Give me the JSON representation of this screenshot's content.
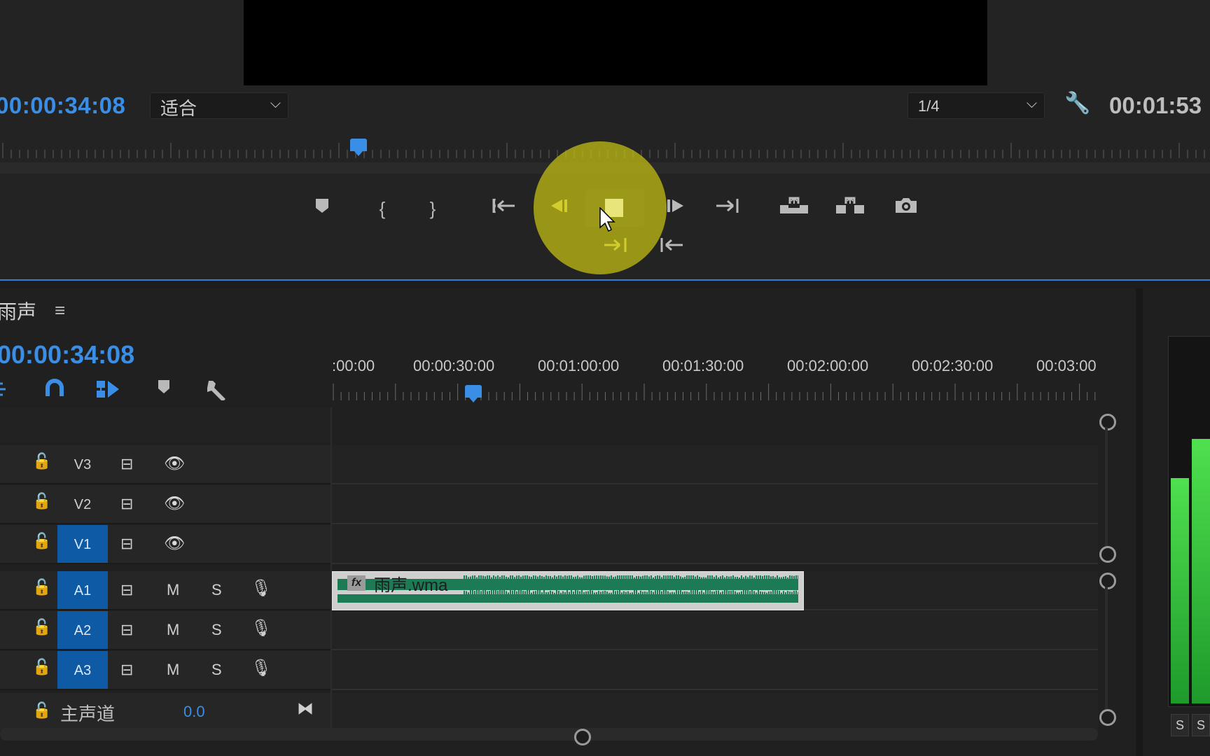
{
  "monitor": {
    "timecode": "00:00:34:08",
    "zoom_fit": "适合",
    "resolution": "1/4",
    "duration": "00:01:53",
    "buttons": [
      "add-marker",
      "mark-in",
      "mark-out",
      "go-to-in",
      "step-back",
      "stop",
      "step-forward",
      "go-to-out",
      "lift",
      "extract",
      "export-frame",
      "insert",
      "overwrite"
    ]
  },
  "timeline": {
    "sequence_name": "雨声",
    "timecode": "00:00:34:08",
    "ruler_labels": [
      ":00:00",
      "00:00:30:00",
      "00:01:00:00",
      "00:01:30:00",
      "00:02:00:00",
      "00:02:30:00",
      "00:03:00"
    ],
    "video_tracks": [
      {
        "name": "V3",
        "targeted": false
      },
      {
        "name": "V2",
        "targeted": false
      },
      {
        "name": "V1",
        "targeted": true
      }
    ],
    "audio_tracks": [
      {
        "name": "A1",
        "mute": "M",
        "solo": "S"
      },
      {
        "name": "A2",
        "mute": "M",
        "solo": "S"
      },
      {
        "name": "A3",
        "mute": "M",
        "solo": "S"
      }
    ],
    "master": {
      "label": "主声道",
      "value": "0.0"
    },
    "clip": {
      "fx": "fx",
      "name": "雨声.wma",
      "color": "#1c7a55"
    }
  },
  "meters": {
    "solo_buttons": [
      "S",
      "S"
    ]
  },
  "colors": {
    "accent": "#3a8ee6",
    "track_target": "#0f5aa5",
    "meter": "#3fcc3f"
  }
}
